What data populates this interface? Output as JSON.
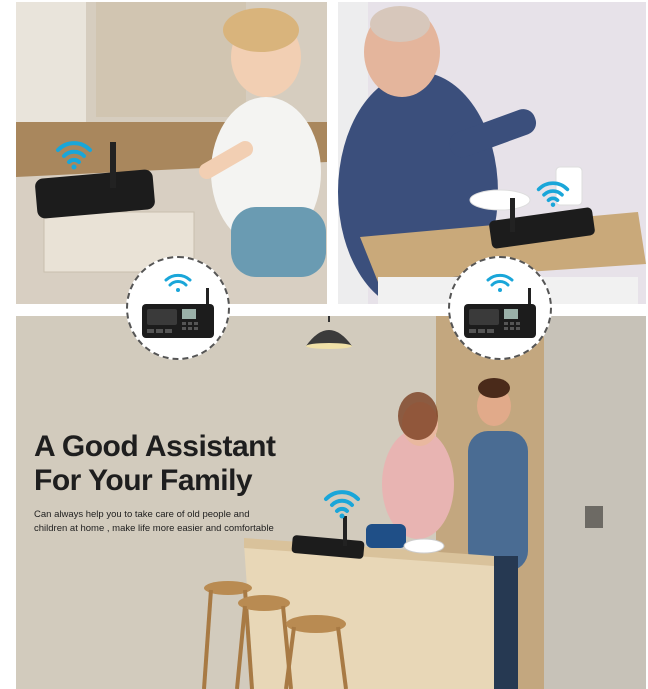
{
  "headline": {
    "line1": "A Good Assistant",
    "line2": "For Your Family"
  },
  "subtext": {
    "line1": "Can always help you to take care of old people and",
    "line2": "children at home , make life more easier and comfortable"
  },
  "colors": {
    "wifi": "#1aa6d9",
    "device": "#1c1c1c",
    "text": "#1e1e1e"
  },
  "icons": {
    "wifi": "wifi-icon",
    "device": "intercom-device"
  }
}
